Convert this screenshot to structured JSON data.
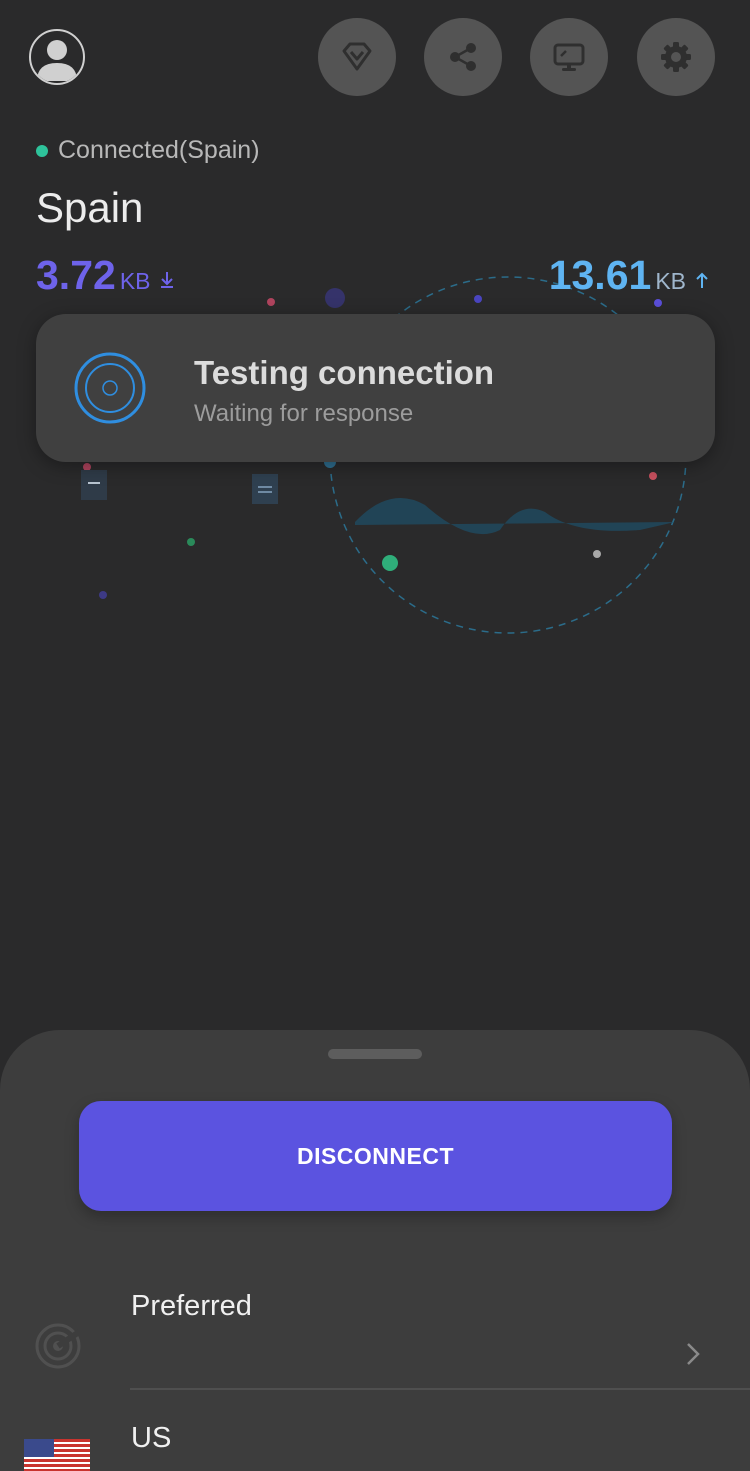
{
  "header": {
    "avatar_icon": "user-avatar-icon",
    "buttons": [
      {
        "icon": "diamond-icon"
      },
      {
        "icon": "share-icon"
      },
      {
        "icon": "monitor-icon"
      },
      {
        "icon": "gear-icon"
      }
    ]
  },
  "status": {
    "text": "Connected(Spain)",
    "dot_color": "#2ec39b"
  },
  "location": {
    "country": "Spain"
  },
  "traffic": {
    "download": {
      "value": "3.72",
      "unit": "KB",
      "color": "#6e63ea"
    },
    "upload": {
      "value": "13.61",
      "unit": "KB",
      "color": "#5fb4f2"
    }
  },
  "toast": {
    "title": "Testing connection",
    "subtitle": "Waiting for response",
    "icon": "target-rings-icon"
  },
  "sheet": {
    "disconnect_label": "DISCONNECT",
    "button_color": "#5b53e0",
    "rows": [
      {
        "label": "Preferred",
        "icon": "radar-icon"
      },
      {
        "label": "US",
        "icon": "us-flag-icon"
      }
    ]
  }
}
